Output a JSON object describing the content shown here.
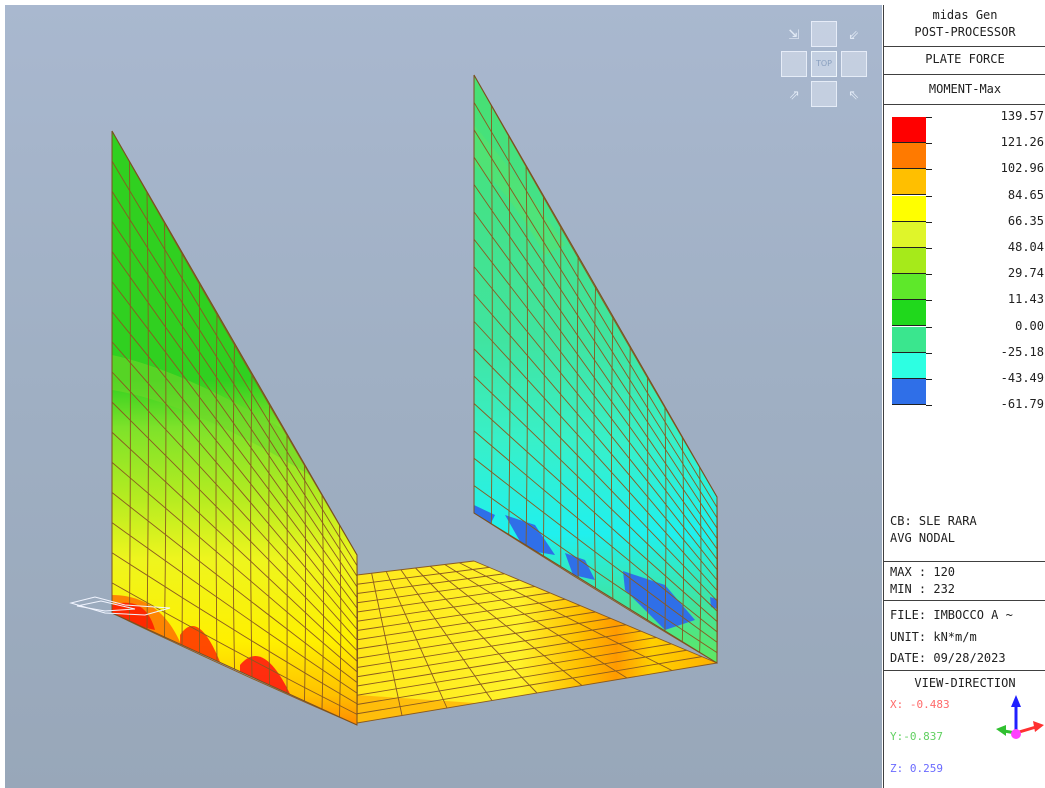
{
  "legend": {
    "app_name": "midas Gen",
    "module": "POST-PROCESSOR",
    "result_type": "PLATE FORCE",
    "component": "MOMENT-Max",
    "scale_values": [
      "139.57",
      "121.26",
      "102.96",
      "84.65",
      "66.35",
      "48.04",
      "29.74",
      "11.43",
      "0.00",
      "-25.18",
      "-43.49",
      "-61.79"
    ],
    "scale_colors": [
      "#ff0000",
      "#ff7a00",
      "#ffbf00",
      "#ffff00",
      "#dff52a",
      "#a6ea1a",
      "#5ee82a",
      "#20d81c",
      "#3ae68e",
      "#2dffe2",
      "#2f6fe8"
    ],
    "combination": "CB: SLE RARA",
    "averaging": "AVG NODAL",
    "max_label": "MAX : 120",
    "min_label": "MIN : 232",
    "file_label": "FILE: IMBOCCO A ~",
    "unit_label": "UNIT: kN*m/m",
    "date_label": "DATE: 09/28/2023",
    "view_direction_title": "VIEW-DIRECTION",
    "view_x": "X: -0.483",
    "view_y": "Y:-0.837",
    "view_z": "Z: 0.259"
  },
  "viewcube": {
    "top_label": "TOP"
  },
  "colors": {
    "mesh_line": "#8a5a20",
    "axis_x": "#ff3030",
    "axis_y": "#30c030",
    "axis_z": "#2020ff",
    "axis_origin": "#ff40ff"
  }
}
